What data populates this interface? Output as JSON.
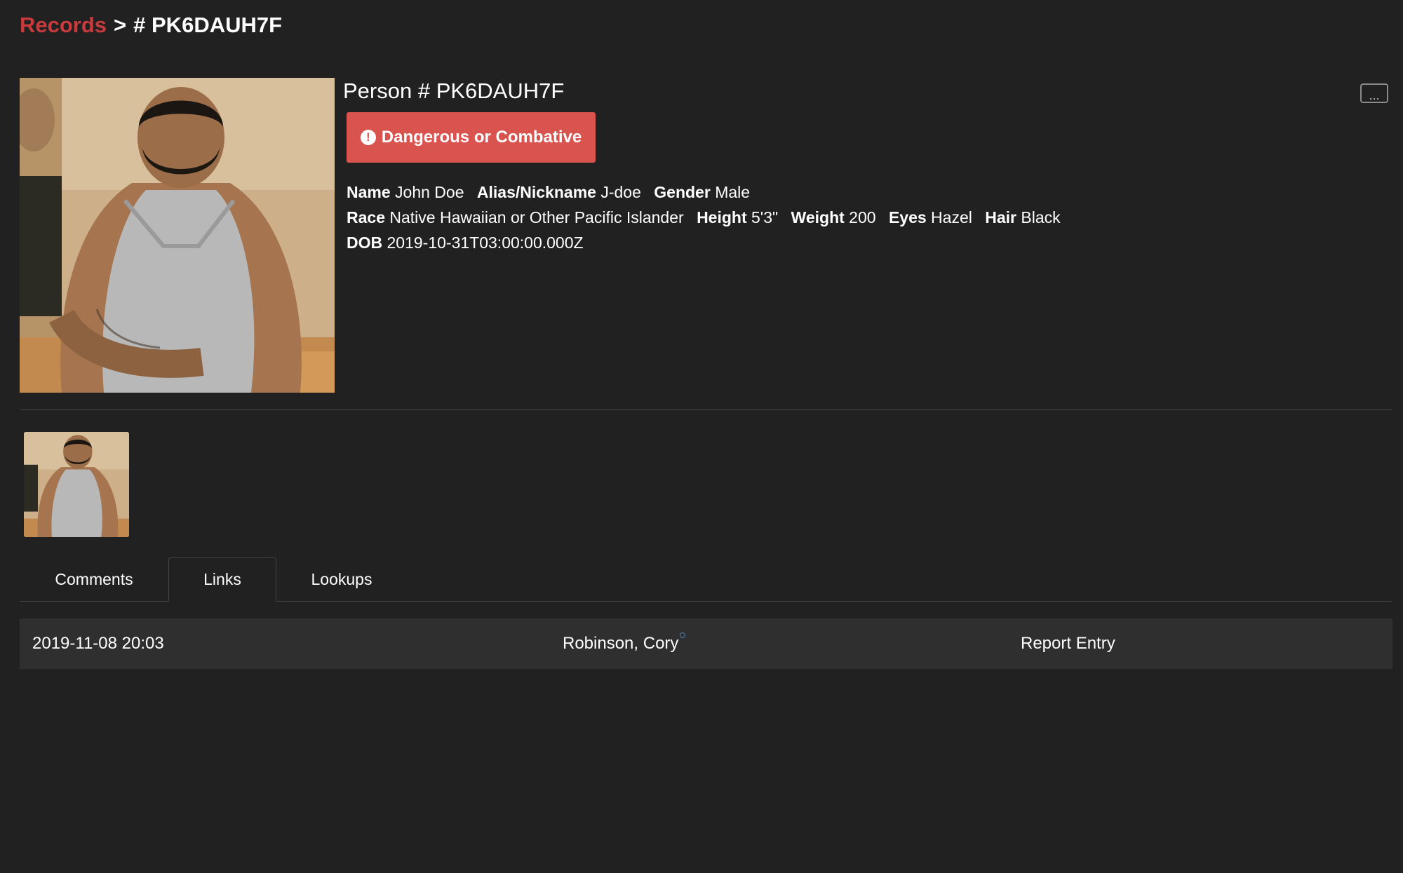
{
  "breadcrumb": {
    "root": "Records",
    "separator": ">",
    "current": "# PK6DAUH7F"
  },
  "person": {
    "title": "Person # PK6DAUH7F",
    "flag_label": "Dangerous or Combative",
    "flag_icon": "exclamation-circle-icon",
    "more_label": "...",
    "details": {
      "name_key": "Name",
      "name": "John Doe",
      "alias_key": "Alias/Nickname",
      "alias": "J-doe",
      "gender_key": "Gender",
      "gender": "Male",
      "race_key": "Race",
      "race": "Native Hawaiian or Other Pacific Islander",
      "height_key": "Height",
      "height": "5'3\"",
      "weight_key": "Weight",
      "weight": "200",
      "eyes_key": "Eyes",
      "eyes": "Hazel",
      "hair_key": "Hair",
      "hair": "Black",
      "dob_key": "DOB",
      "dob": "2019-10-31T03:00:00.000Z"
    }
  },
  "tabs": [
    {
      "label": "Comments",
      "active": false
    },
    {
      "label": "Links",
      "active": true
    },
    {
      "label": "Lookups",
      "active": false
    }
  ],
  "links": [
    {
      "date": "2019-11-08  20:03",
      "author": "Robinson, Cory",
      "type": "Report Entry"
    }
  ],
  "colors": {
    "background": "#212121",
    "accent": "#c93a3d",
    "flag": "#d9534f",
    "row": "#2f2f2f"
  }
}
